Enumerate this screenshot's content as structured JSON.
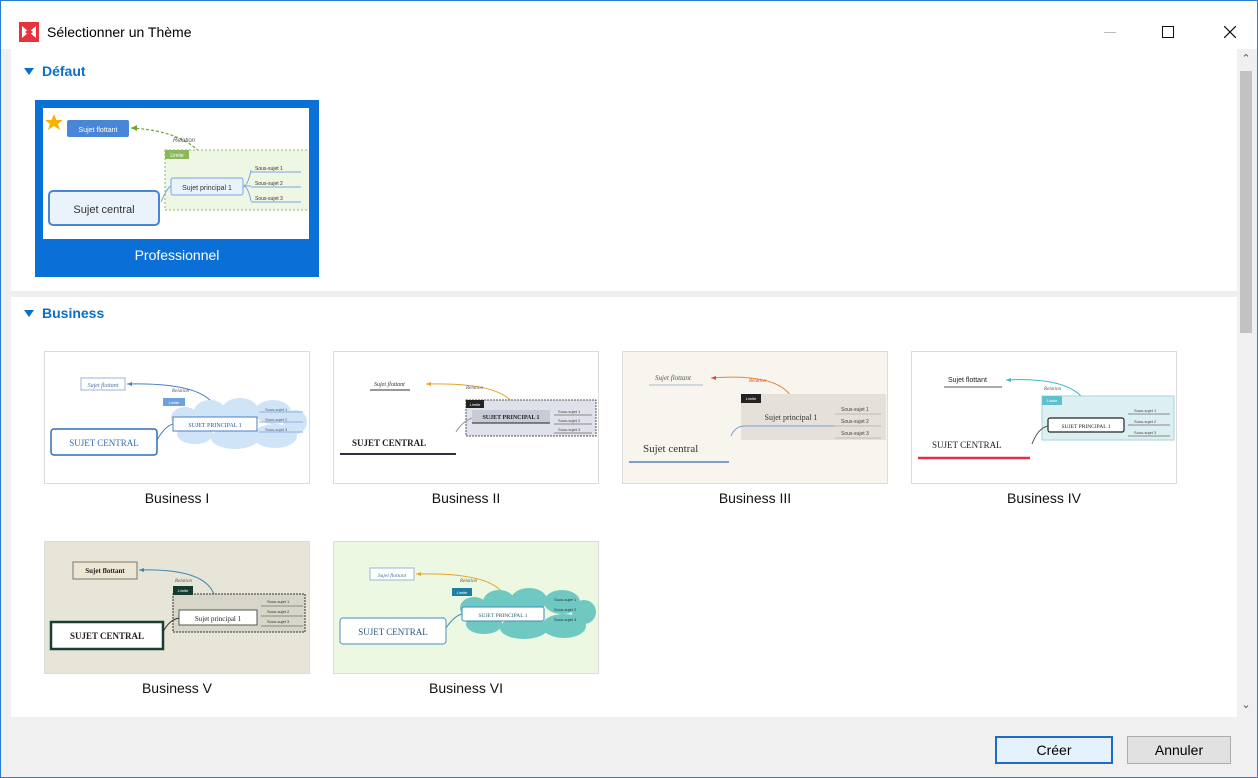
{
  "window": {
    "title": "Sélectionner un Thème",
    "app_icon": "xmind-logo-icon",
    "controls": [
      "minimize-icon",
      "maximize-icon",
      "close-icon"
    ]
  },
  "sections": [
    {
      "title": "Défaut",
      "themes": [
        {
          "label": "Professionnel",
          "selected": true
        }
      ]
    },
    {
      "title": "Business",
      "themes": [
        {
          "label": "Business I"
        },
        {
          "label": "Business II"
        },
        {
          "label": "Business III"
        },
        {
          "label": "Business IV"
        },
        {
          "label": "Business V"
        },
        {
          "label": "Business VI"
        }
      ]
    }
  ],
  "thumb_text": {
    "floating": "Sujet flottant",
    "relation": "Relation",
    "boundary": "Limite",
    "main": "Sujet principal 1",
    "main_caps": "SUJET PRINCIPAL 1",
    "sub1": "Sous-sujet 1",
    "sub2": "Sous-sujet 2",
    "sub3": "Sous-sujet 3",
    "central": "Sujet central",
    "central_caps": "SUJET CENTRAL"
  },
  "buttons": {
    "create": "Créer",
    "cancel": "Annuler"
  },
  "colors": {
    "accent": "#0a6fd6",
    "section_title": "#0a6fc9"
  }
}
